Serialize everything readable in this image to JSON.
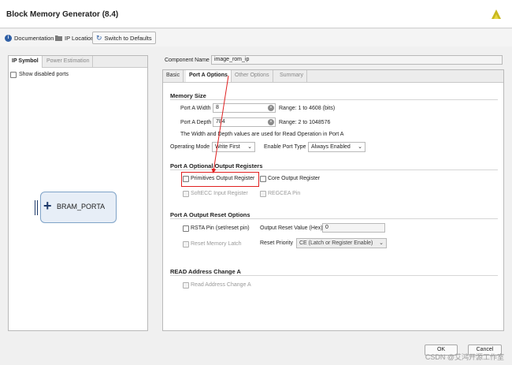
{
  "window": {
    "title": "Block Memory Generator (8.4)"
  },
  "toolbar": {
    "documentation": "Documentation",
    "ip_location": "IP Location",
    "switch_defaults": "Switch to Defaults"
  },
  "left_panel": {
    "tabs": [
      "IP Symbol",
      "Power Estimation"
    ],
    "show_disabled": "Show disabled ports",
    "symbol_label": "BRAM_PORTA"
  },
  "component": {
    "label": "Component Name",
    "value": "image_rom_ip"
  },
  "right_tabs": [
    "Basic",
    "Port A Options",
    "Other Options",
    "Summary"
  ],
  "memory_size": {
    "title": "Memory Size",
    "width_label": "Port A Width",
    "width_value": "8",
    "width_range": "Range: 1 to 4608 (bits)",
    "depth_label": "Port A Depth",
    "depth_value": "784",
    "depth_range": "Range: 2 to 1048576",
    "note": "The Width and Depth values are used for Read Operation in Port A",
    "op_mode_label": "Operating Mode",
    "op_mode_value": "Write First",
    "enable_label": "Enable Port Type",
    "enable_value": "Always Enabled"
  },
  "output_registers": {
    "title": "Port A Optional Output Registers",
    "primitives": "Primitives Output Register",
    "core": "Core Output Register",
    "softecc": "SoftECC Input Register",
    "regcea": "REGCEA Pin"
  },
  "reset_options": {
    "title": "Port A Output Reset Options",
    "rsta": "RSTA Pin (set/reset pin)",
    "reset_value_label": "Output Reset Value (Hex)",
    "reset_value": "0",
    "reset_latch": "Reset Memory Latch",
    "priority_label": "Reset Priority",
    "priority_value": "CE (Latch or Register Enable)"
  },
  "read_address": {
    "title": "READ Address Change A",
    "read_change": "Read Address Change A"
  },
  "buttons": {
    "ok": "OK",
    "cancel": "Cancel"
  },
  "watermark": "CSDN @艾鸿开源工作室",
  "colors": {
    "highlight": "#e02020",
    "accent": "#2f5fa5"
  }
}
